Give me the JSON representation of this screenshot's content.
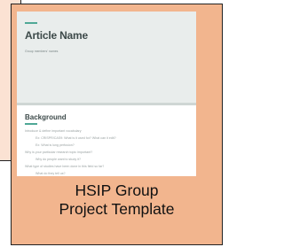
{
  "document": {
    "title": "Article Name",
    "members": "Group members' names",
    "section_title": "Background",
    "lines": [
      "Introduce & define important vocabulary",
      "Ex: CRISPR/CAS9: What is it used for? What can it edit?",
      "Ex: What is lung perfusion?",
      "Why is your particular research topic important?",
      "Why do people want to study it?",
      "What type of studies have been done in this field so far?",
      "What do they tell us?"
    ]
  },
  "caption": {
    "line1": "HSIP Group",
    "line2": "Project Template"
  },
  "colors": {
    "frame": "#f2b58e",
    "back_card": "#fbe2d3",
    "accent": "#4fa896",
    "doc_header": "#e9edec"
  }
}
